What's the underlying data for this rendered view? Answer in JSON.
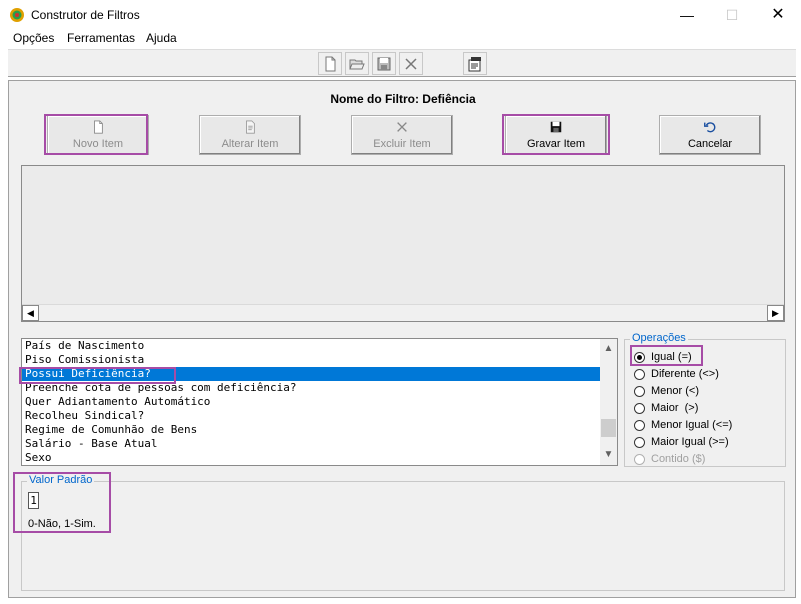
{
  "window": {
    "title": "Construtor de Filtros",
    "minimize_glyph": "—",
    "maximize_glyph": "☐",
    "close_glyph": "✕"
  },
  "menu": [
    "Opções",
    "Ferramentas",
    "Ajuda"
  ],
  "toolbar": {
    "icons": [
      "new-document-icon",
      "open-folder-icon",
      "save-disk-icon",
      "delete-x-icon",
      "properties-icon"
    ]
  },
  "filter": {
    "title": "Nome do Filtro: Defiência"
  },
  "actions": {
    "novo": "Novo Item",
    "alterar": "Alterar Item",
    "excluir": "Excluir Item",
    "gravar": "Gravar Item",
    "cancelar": "Cancelar"
  },
  "scroll": {
    "left": "◀",
    "right": "▶",
    "up": "▲",
    "down": "▼"
  },
  "fields": [
    "País de Nascimento",
    "Piso Comissionista",
    "Possui Deficiência?",
    "Preenche cota de pessoas com deficiência?",
    "Quer Adiantamento Automático",
    "Recolheu Sindical?",
    "Regime de Comunhão de Bens",
    "Salário - Base Atual",
    "Sexo"
  ],
  "selected_field_index": 2,
  "operations": {
    "legend": "Operações",
    "items": [
      "Igual (=)",
      "Diferente (<>)",
      "Menor (<)",
      "Maior  (>)",
      "Menor Igual (<=)",
      "Maior Igual (>=)",
      "Contido ($)"
    ],
    "selected": "Igual (=)",
    "disabled": [
      "Contido ($)"
    ]
  },
  "default_value": {
    "legend": "Valor Padrão",
    "value": "1",
    "hint": "0-Não, 1-Sim."
  },
  "colors": {
    "highlight": "#a64ca6",
    "selection": "#0078d7",
    "legend": "#0066cc"
  }
}
